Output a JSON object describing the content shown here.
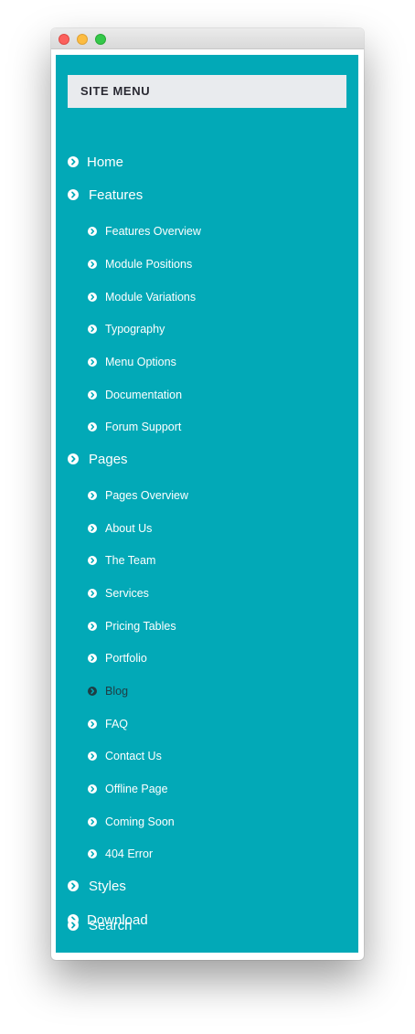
{
  "window": {
    "buttons": [
      "close",
      "minimize",
      "maximize"
    ]
  },
  "menu": {
    "title": "SITE MENU",
    "items": [
      {
        "label": "Home",
        "level": 1
      },
      {
        "label": "Features",
        "level": 1
      },
      {
        "label": "Features Overview",
        "level": 2
      },
      {
        "label": "Module Positions",
        "level": 2
      },
      {
        "label": "Module Variations",
        "level": 2
      },
      {
        "label": "Typography",
        "level": 2
      },
      {
        "label": "Menu Options",
        "level": 2
      },
      {
        "label": "Documentation",
        "level": 2
      },
      {
        "label": "Forum Support",
        "level": 2
      },
      {
        "label": "Pages",
        "level": 1
      },
      {
        "label": "Pages Overview",
        "level": 2
      },
      {
        "label": "About Us",
        "level": 2
      },
      {
        "label": "The Team",
        "level": 2
      },
      {
        "label": "Services",
        "level": 2
      },
      {
        "label": "Pricing Tables",
        "level": 2
      },
      {
        "label": "Portfolio",
        "level": 2
      },
      {
        "label": "Blog",
        "level": 2,
        "active": true
      },
      {
        "label": "FAQ",
        "level": 2
      },
      {
        "label": "Contact Us",
        "level": 2
      },
      {
        "label": "Offline Page",
        "level": 2
      },
      {
        "label": "Coming Soon",
        "level": 2
      },
      {
        "label": "404 Error",
        "level": 2
      },
      {
        "label": "Styles",
        "level": 1
      },
      {
        "label": "Download",
        "level": 1
      },
      {
        "label": "Search",
        "level": 1
      }
    ],
    "icon": "chevron-circle-right-icon"
  },
  "colors": {
    "panel": "#02a9b7",
    "header_bg": "#e9ebee",
    "header_text": "#2a2a33",
    "item_text": "#ffffff",
    "active_text": "#1f3d44"
  }
}
